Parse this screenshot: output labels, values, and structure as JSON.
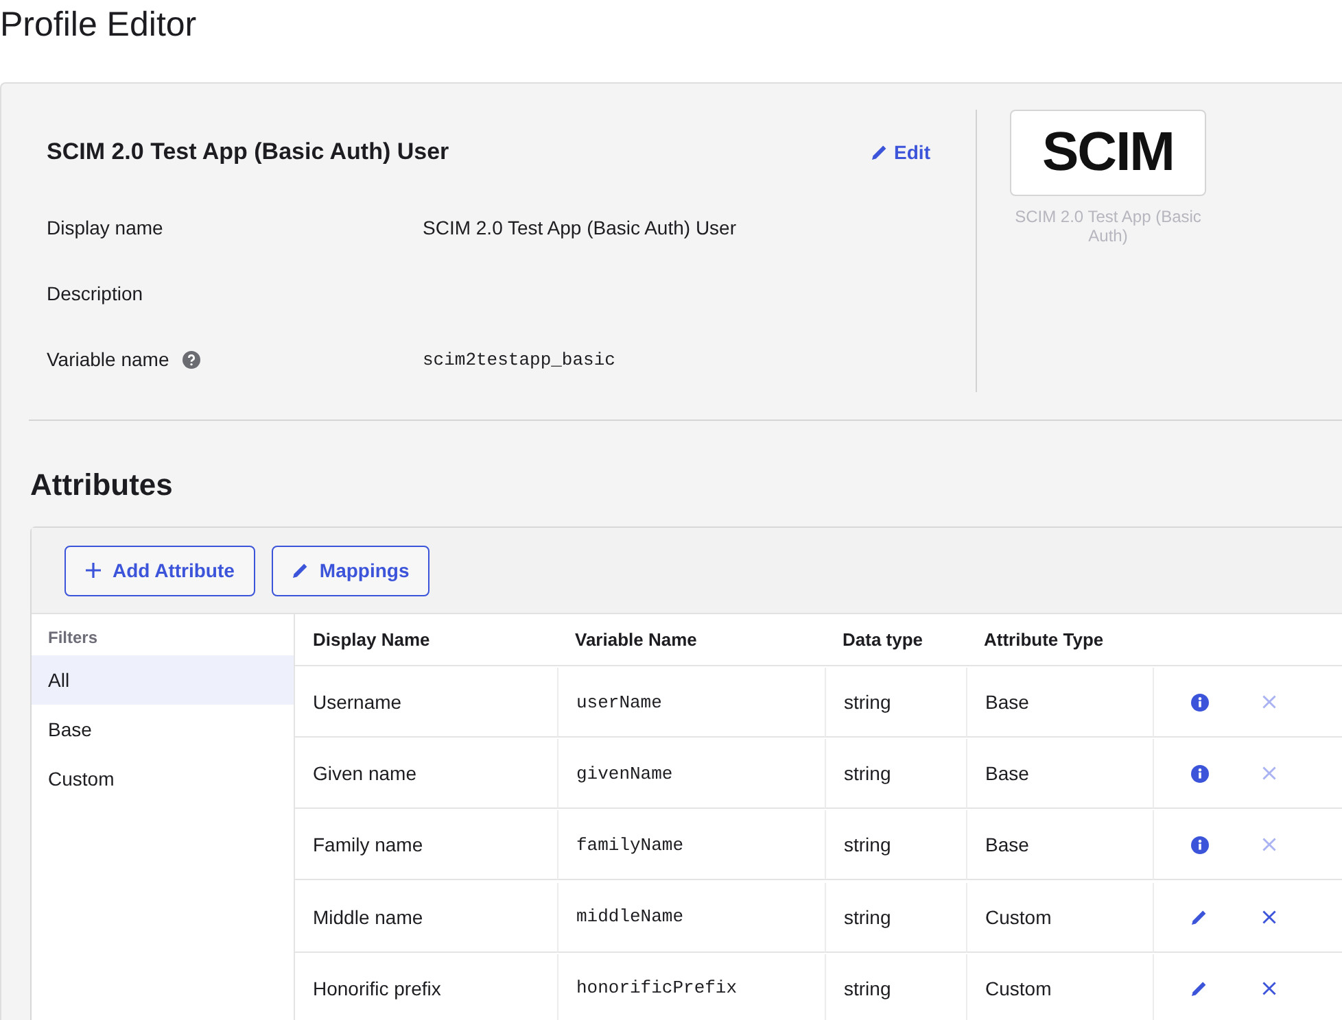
{
  "page": {
    "title": "Profile Editor"
  },
  "profile": {
    "title": "SCIM 2.0 Test App (Basic Auth) User",
    "edit_link": "Edit",
    "fields": [
      {
        "label": "Display name",
        "value": "SCIM 2.0 Test App (Basic Auth) User",
        "kind": "text",
        "help": false
      },
      {
        "label": "Description",
        "kind": "text",
        "help": false
      },
      {
        "label": "Variable name",
        "value": "scim2testapp_basic",
        "kind": "code",
        "help": true
      }
    ],
    "logo": {
      "text": "SCIM",
      "caption": "SCIM 2.0 Test App (Basic Auth)"
    }
  },
  "attributes": {
    "title": "Attributes",
    "buttons": [
      {
        "label": "Add Attribute",
        "kind": "add"
      },
      {
        "label": "Mappings",
        "kind": "edit"
      }
    ],
    "filters": {
      "title": "Filters",
      "items": [
        {
          "label": "All",
          "selected": true
        },
        {
          "label": "Base",
          "selected": false
        },
        {
          "label": "Custom",
          "selected": false
        }
      ]
    },
    "table": {
      "columns": [
        "Display Name",
        "Variable Name",
        "Data type",
        "Attribute Type"
      ],
      "rows": [
        {
          "display_name": "Username",
          "variable_name": "userName",
          "data_type": "string",
          "attribute_type": "Base",
          "kind": "info",
          "removable": false
        },
        {
          "display_name": "Given name",
          "variable_name": "givenName",
          "data_type": "string",
          "attribute_type": "Base",
          "kind": "info",
          "removable": false
        },
        {
          "display_name": "Family name",
          "variable_name": "familyName",
          "data_type": "string",
          "attribute_type": "Base",
          "kind": "info",
          "removable": false
        },
        {
          "display_name": "Middle name",
          "variable_name": "middleName",
          "data_type": "string",
          "attribute_type": "Custom",
          "kind": "edit",
          "removable": true
        },
        {
          "display_name": "Honorific prefix",
          "variable_name": "honorificPrefix",
          "data_type": "string",
          "attribute_type": "Custom",
          "kind": "edit",
          "removable": true
        }
      ]
    }
  }
}
